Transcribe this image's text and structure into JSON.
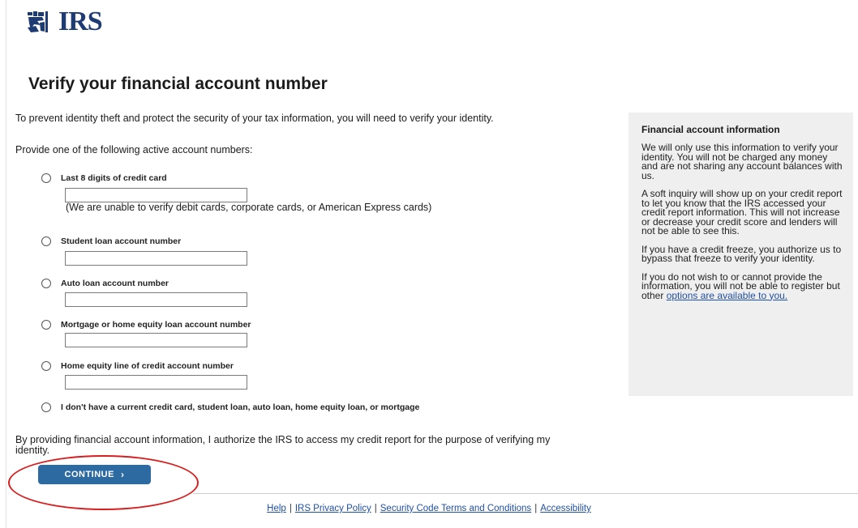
{
  "brand": {
    "wordmark": "IRS",
    "accent": "#1f3b73"
  },
  "page": {
    "title": "Verify your financial account number"
  },
  "intro": {
    "text": "To prevent identity theft and protect the security of your tax information, you will need to verify your identity.",
    "provide": "Provide one of the following active account numbers:"
  },
  "options": [
    {
      "label": "Last 8 digits of credit card",
      "value": ""
    },
    {
      "label": "Student loan account number",
      "value": ""
    },
    {
      "label": "Auto loan account number",
      "value": ""
    },
    {
      "label": "Mortgage or home equity loan account number",
      "value": ""
    },
    {
      "label": "Home equity line of credit account number",
      "value": ""
    },
    {
      "label": "I don't have a current credit card, student loan, auto loan, home equity loan, or mortgage"
    }
  ],
  "credit_card_note": "(We are unable to verify debit cards, corporate cards, or American Express cards)",
  "authorize_text": "By providing financial account information, I authorize the IRS to access my credit report for the purpose of verifying my identity.",
  "continue_button": {
    "label": "CONTINUE",
    "icon": "chevron-right-icon",
    "color": "#2e6aa2"
  },
  "sidebar": {
    "title": "Financial account information",
    "p1": "We will only use this information to verify your identity. You will not be charged any money and are not sharing any account balances with us.",
    "p2": "A soft inquiry will show up on your credit report to let you know that the IRS accessed your credit report information. This will not increase or decrease your credit score and lenders will not be able to see this.",
    "p3": "If you have a credit freeze, you authorize us to bypass that freeze to verify your identity.",
    "p4_text": "If you do not wish to or cannot provide the information, you will not be able to register but other",
    "p4_link": "options are available to you."
  },
  "footer": {
    "links": [
      "Help",
      "IRS Privacy Policy",
      "Security Code Terms and Conditions",
      "Accessibility"
    ],
    "separator": "|"
  },
  "annotation_color": "#d81e1e"
}
